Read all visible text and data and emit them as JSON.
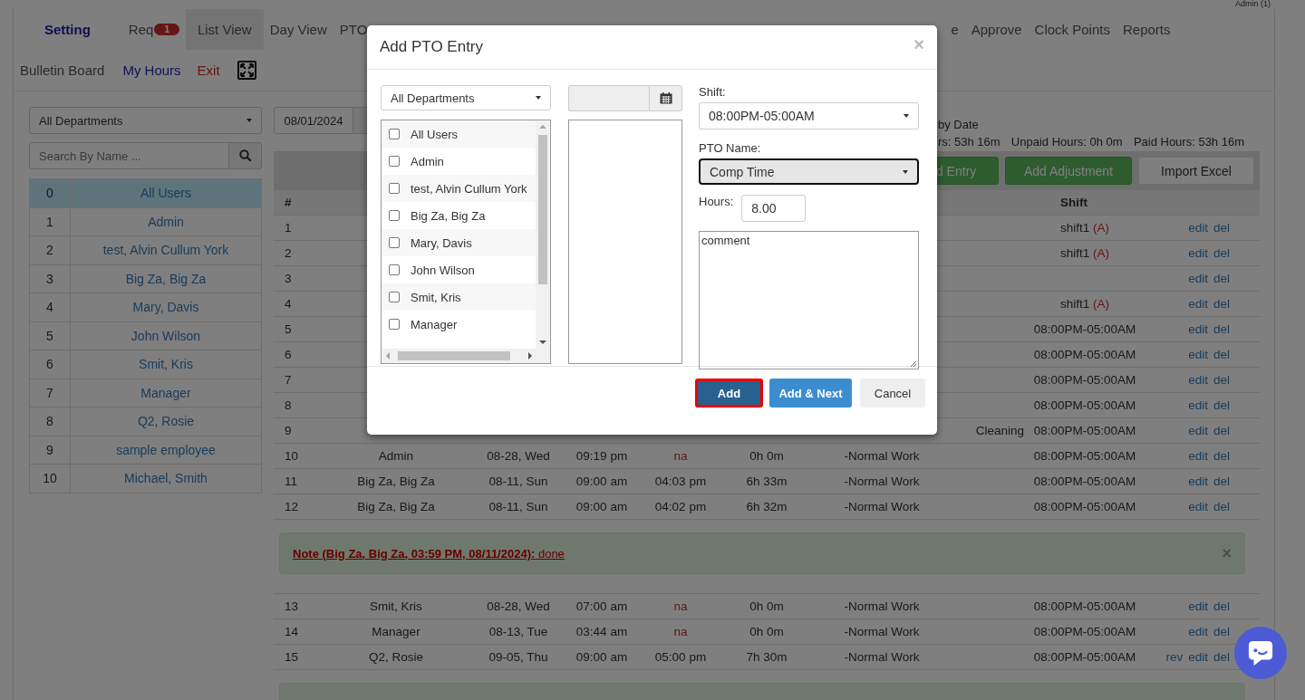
{
  "account": "Admin (1)",
  "nav": [
    {
      "label": "Setting",
      "kind": "title",
      "selected": false
    },
    {
      "label": "Req",
      "kind": "tab",
      "selected": false,
      "badge": "1"
    },
    {
      "label": "List View",
      "kind": "tab",
      "selected": true
    },
    {
      "label": "Day View",
      "kind": "tab",
      "selected": false
    },
    {
      "label": "PTO",
      "kind": "tab",
      "selected": false
    },
    {
      "label": "e",
      "kind": "tab",
      "selected": false
    },
    {
      "label": "Approve",
      "kind": "tab",
      "selected": false
    },
    {
      "label": "Clock Points",
      "kind": "tab",
      "selected": false
    },
    {
      "label": "Reports",
      "kind": "tab",
      "selected": false
    }
  ],
  "links": [
    {
      "label": "Bulletin Board",
      "kind": "plain"
    },
    {
      "label": "My Hours",
      "kind": "user"
    },
    {
      "label": "Exit",
      "kind": "danger"
    }
  ],
  "sidebar": {
    "department": "All Departments",
    "search_placeholder": "Search By Name ...",
    "users": [
      {
        "num": "0",
        "name": "All Users",
        "selected": true
      },
      {
        "num": "1",
        "name": "Admin",
        "selected": false
      },
      {
        "num": "2",
        "name": "test, Alvin Cullum York",
        "selected": false
      },
      {
        "num": "3",
        "name": "Big Za, Big Za",
        "selected": false
      },
      {
        "num": "4",
        "name": "Mary, Davis",
        "selected": false
      },
      {
        "num": "5",
        "name": "John Wilson",
        "selected": false
      },
      {
        "num": "6",
        "name": "Smit, Kris",
        "selected": false
      },
      {
        "num": "7",
        "name": "Manager",
        "selected": false
      },
      {
        "num": "8",
        "name": "Q2, Rosie",
        "selected": false
      },
      {
        "num": "9",
        "name": "sample employee",
        "selected": false
      },
      {
        "num": "10",
        "name": "Michael, Smith",
        "selected": false
      }
    ]
  },
  "filters": {
    "start_date": "08/01/2024",
    "mode": "by Date"
  },
  "totals": [
    {
      "text": "rs: 53h 16m"
    },
    {
      "text": "Unpaid Hours: 0h 0m"
    },
    {
      "text": "Paid Hours: 53h 16m"
    }
  ],
  "toolbar": [
    {
      "label": "d Entry",
      "kind": "success"
    },
    {
      "label": "Add Adjustment",
      "kind": "success"
    },
    {
      "label": "Import Excel",
      "kind": "default"
    }
  ],
  "table": {
    "columns": {
      "num": "#",
      "shift": "Shift"
    },
    "rows": [
      {
        "kind": "row",
        "num": "1",
        "shift": "shift1",
        "shift_tag": "(A)",
        "actions": [
          "edit",
          "del"
        ]
      },
      {
        "kind": "row",
        "num": "2",
        "shift": "shift1",
        "shift_tag": "(A)",
        "actions": [
          "edit",
          "del"
        ]
      },
      {
        "kind": "row",
        "num": "3",
        "actions": [
          "edit",
          "del"
        ]
      },
      {
        "kind": "row",
        "num": "4",
        "shift": "shift1",
        "shift_tag": "(A)",
        "actions": [
          "edit",
          "del"
        ]
      },
      {
        "kind": "row",
        "num": "5",
        "shift": "08:00PM-05:00AM",
        "actions": [
          "edit",
          "del"
        ]
      },
      {
        "kind": "row",
        "num": "6",
        "shift": "08:00PM-05:00AM",
        "actions": [
          "edit",
          "del"
        ]
      },
      {
        "kind": "row",
        "num": "7",
        "shift": "08:00PM-05:00AM",
        "actions": [
          "edit",
          "del"
        ]
      },
      {
        "kind": "row",
        "num": "8",
        "shift": "08:00PM-05:00AM",
        "actions": [
          "edit",
          "del"
        ]
      },
      {
        "kind": "row",
        "num": "9",
        "dept": "Cleaning",
        "shift": "08:00PM-05:00AM",
        "actions": [
          "edit",
          "del"
        ]
      },
      {
        "kind": "row",
        "num": "10",
        "name": "Admin",
        "date": "08-28, Wed",
        "in": "09:19 pm",
        "out": "na",
        "out_missing": true,
        "hours": "0h 0m",
        "dept": "-Normal Work",
        "shift": "08:00PM-05:00AM",
        "actions": [
          "edit",
          "del"
        ]
      },
      {
        "kind": "row",
        "num": "11",
        "name": "Big Za, Big Za",
        "date": "08-11, Sun",
        "in": "09:00 am",
        "out": "04:03 pm",
        "out_missing": false,
        "hours": "6h 33m",
        "dept": "-Normal Work",
        "shift": "08:00PM-05:00AM",
        "actions": [
          "edit",
          "del"
        ]
      },
      {
        "kind": "row",
        "num": "12",
        "name": "Big Za, Big Za",
        "date": "08-11, Sun",
        "in": "09:00 am",
        "out": "04:02 pm",
        "out_missing": false,
        "hours": "6h 32m",
        "dept": "-Normal Work",
        "shift": "08:00PM-05:00AM",
        "actions": [
          "edit",
          "del"
        ]
      },
      {
        "kind": "note",
        "text": "Note (Big Za, Big Za, 03:59 PM, 08/11/2024):",
        "detail": "done",
        "close": "×"
      },
      {
        "kind": "row",
        "num": "13",
        "name": "Smit, Kris",
        "date": "08-28, Wed",
        "in": "07:00 am",
        "out": "na",
        "out_missing": true,
        "hours": "0h 0m",
        "dept": "-Normal Work",
        "shift": "08:00PM-05:00AM",
        "actions": [
          "edit",
          "del"
        ]
      },
      {
        "kind": "row",
        "num": "14",
        "name": "Manager",
        "date": "08-13, Tue",
        "in": "03:44 am",
        "out": "na",
        "out_missing": true,
        "hours": "0h 0m",
        "dept": "-Normal Work",
        "shift": "08:00PM-05:00AM",
        "actions": [
          "edit",
          "del"
        ]
      },
      {
        "kind": "row",
        "num": "15",
        "name": "Q2, Rosie",
        "date": "09-05, Thu",
        "in": "09:00 am",
        "out": "05:00 pm",
        "out_missing": false,
        "hours": "7h 30m",
        "dept": "-Normal Work",
        "shift": "08:00PM-05:00AM",
        "actions": [
          "rev",
          "edit",
          "del"
        ]
      },
      {
        "kind": "note"
      }
    ]
  },
  "modal": {
    "title": "Add PTO Entry",
    "close": "×",
    "department": "All Departments",
    "users": [
      {
        "name": "All Users",
        "checked": false
      },
      {
        "name": "Admin",
        "checked": false
      },
      {
        "name": "test, Alvin Cullum York",
        "checked": false
      },
      {
        "name": "Big Za, Big Za",
        "checked": false
      },
      {
        "name": "Mary, Davis",
        "checked": false
      },
      {
        "name": "John Wilson",
        "checked": false
      },
      {
        "name": "Smit, Kris",
        "checked": false
      },
      {
        "name": "Manager",
        "checked": false
      }
    ],
    "shift_label": "Shift:",
    "shift": "08:00PM-05:00AM",
    "pto_label": "PTO Name:",
    "pto": "Comp Time",
    "hours_label": "Hours:",
    "hours": "8.00",
    "comment": "comment",
    "buttons": [
      {
        "label": "Add",
        "kind": "primary",
        "focused": true
      },
      {
        "label": "Add & Next",
        "kind": "info",
        "focused": false
      },
      {
        "label": "Cancel",
        "kind": "default",
        "focused": false
      }
    ]
  }
}
